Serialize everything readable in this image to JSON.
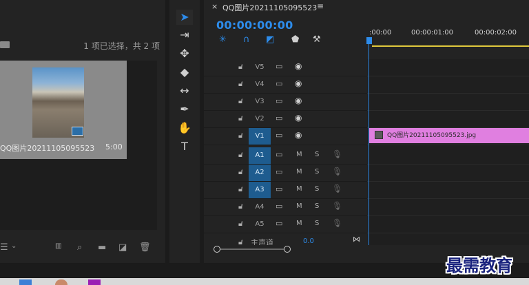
{
  "project": {
    "status_text": "1 项已选择，共 2 项",
    "item": {
      "name": "QQ图片20211105095523",
      "duration": "5:00"
    },
    "bottom_icons": [
      "list-view-icon",
      "chevron-down-icon",
      "storyboard-icon",
      "find-icon",
      "new-bin-icon",
      "new-item-icon",
      "trash-icon"
    ]
  },
  "tools": [
    "selection-tool-icon",
    "track-select-tool-icon",
    "ripple-edit-tool-icon",
    "razor-tool-icon",
    "slip-tool-icon",
    "pen-tool-icon",
    "hand-tool-icon",
    "type-tool-icon"
  ],
  "timeline": {
    "tab_title": "QQ图片20211105095523",
    "timecode": "00:00:00:00",
    "ruler_labels": [
      ":00:00",
      "00:00:01:00",
      "00:00:02:00"
    ],
    "video_tracks": [
      {
        "name": "V5",
        "active": false
      },
      {
        "name": "V4",
        "active": false
      },
      {
        "name": "V3",
        "active": false
      },
      {
        "name": "V2",
        "active": false
      },
      {
        "name": "V1",
        "active": true
      }
    ],
    "audio_tracks": [
      {
        "name": "A1",
        "active": true,
        "m": "M",
        "s": "S"
      },
      {
        "name": "A2",
        "active": true,
        "m": "M",
        "s": "S"
      },
      {
        "name": "A3",
        "active": true,
        "m": "M",
        "s": "S"
      },
      {
        "name": "A4",
        "active": false,
        "m": "M",
        "s": "S"
      },
      {
        "name": "A5",
        "active": false,
        "m": "M",
        "s": "S"
      }
    ],
    "master_label": "主声道",
    "master_value": "0.0",
    "clip_label": "QQ图片20211105095523.jpg"
  },
  "watermark": "最需教育",
  "colors": {
    "accent": "#2d8ceb",
    "clip": "#e07fe0",
    "active_track": "#1e5c8f",
    "work_bar": "#e1c93d"
  }
}
